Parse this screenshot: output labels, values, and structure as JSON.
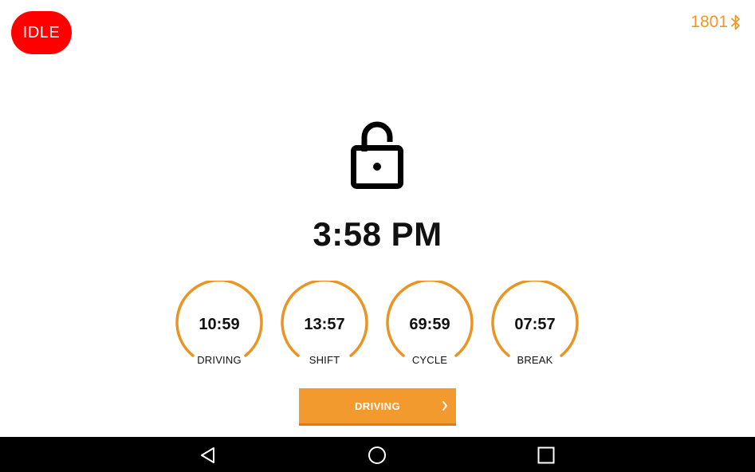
{
  "status": {
    "label": "IDLE",
    "color": "#ff0000"
  },
  "connection": {
    "unit": "1801",
    "icon": "bluetooth-icon",
    "color": "#f0962a"
  },
  "lock": {
    "icon": "unlocked-padlock-icon"
  },
  "clock": {
    "time": "3:58 PM"
  },
  "timers": [
    {
      "value": "10:59",
      "label": "DRIVING"
    },
    {
      "value": "13:57",
      "label": "SHIFT"
    },
    {
      "value": "69:59",
      "label": "CYCLE"
    },
    {
      "value": "07:57",
      "label": "BREAK"
    }
  ],
  "action": {
    "label": "DRIVING",
    "color": "#f39a2e",
    "icon": "chevron-right-icon"
  },
  "navbar": {
    "back_icon": "back-triangle-icon",
    "home_icon": "home-circle-icon",
    "recents_icon": "recents-square-icon"
  }
}
